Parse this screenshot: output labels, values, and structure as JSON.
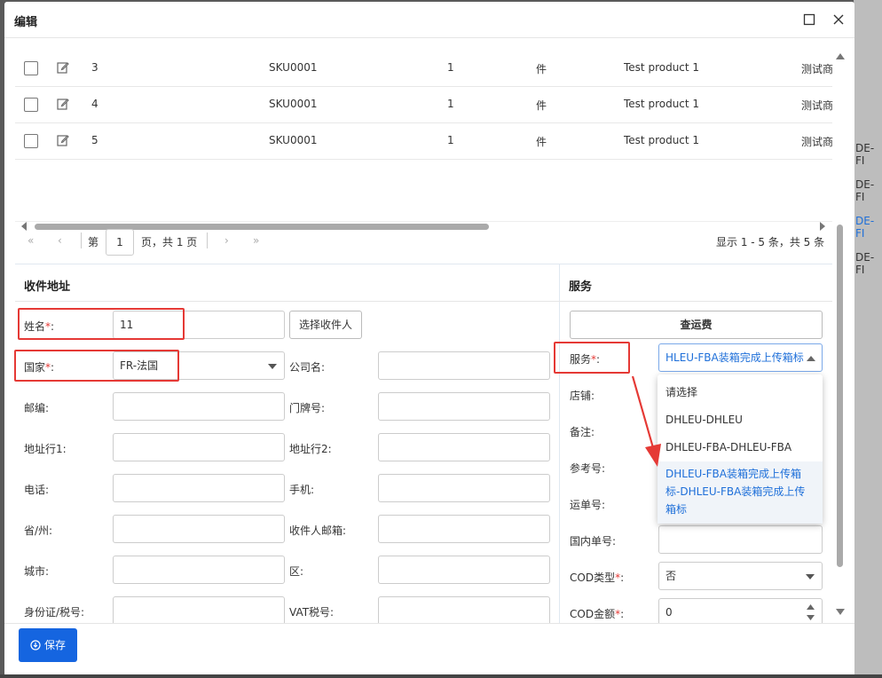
{
  "dialog": {
    "title": "编辑"
  },
  "background_right_texts": [
    "DE-FI",
    "DE-FI",
    "DE-FI",
    "DE-FI"
  ],
  "table": {
    "rows": [
      {
        "idx": "3",
        "sku": "SKU0001",
        "qty": "1",
        "unit": "件",
        "name": "Test product 1",
        "cn_name": "测试商"
      },
      {
        "idx": "4",
        "sku": "SKU0001",
        "qty": "1",
        "unit": "件",
        "name": "Test product 1",
        "cn_name": "测试商"
      },
      {
        "idx": "5",
        "sku": "SKU0001",
        "qty": "1",
        "unit": "件",
        "name": "Test product 1",
        "cn_name": "测试商"
      }
    ]
  },
  "pager": {
    "page_prefix": "第",
    "page_value": "1",
    "page_suffix": "页，共 1 页",
    "summary": "显示 1 - 5 条，共 5 条"
  },
  "address": {
    "title": "收件地址",
    "name_label": "姓名",
    "name_value": "11",
    "choose_recipient": "选择收件人",
    "country_label": "国家",
    "country_value": "FR-法国",
    "company_label": "公司名:",
    "postcode_label": "邮编:",
    "house_no_label": "门牌号:",
    "addr1_label": "地址行1:",
    "addr2_label": "地址行2:",
    "phone_label": "电话:",
    "mobile_label": "手机:",
    "province_label": "省/州:",
    "email_label": "收件人邮箱:",
    "city_label": "城市:",
    "district_label": "区:",
    "id_label": "身份证/税号:",
    "vat_label": "VAT税号:"
  },
  "service": {
    "title": "服务",
    "check_fee": "查运费",
    "service_label": "服务",
    "service_value": "HLEU-FBA装箱完成上传箱标",
    "store_label": "店铺:",
    "remark_label": "备注:",
    "ref_label": "参考号:",
    "waybill_label": "运单号:",
    "domestic_label": "国内单号:",
    "cod_type_label": "COD类型",
    "cod_type_value": "否",
    "cod_amount_label": "COD金额",
    "cod_amount_value": "0",
    "options": [
      "请选择",
      "DHLEU-DHLEU",
      "DHLEU-FBA-DHLEU-FBA",
      "DHLEU-FBA装箱完成上传箱标-DHLEU-FBA装箱完成上传箱标"
    ]
  },
  "required_mark": "*",
  "colon": ":",
  "footer": {
    "save_label": "保存"
  },
  "colors": {
    "accent": "#1565e0",
    "highlight": "#e53935"
  }
}
